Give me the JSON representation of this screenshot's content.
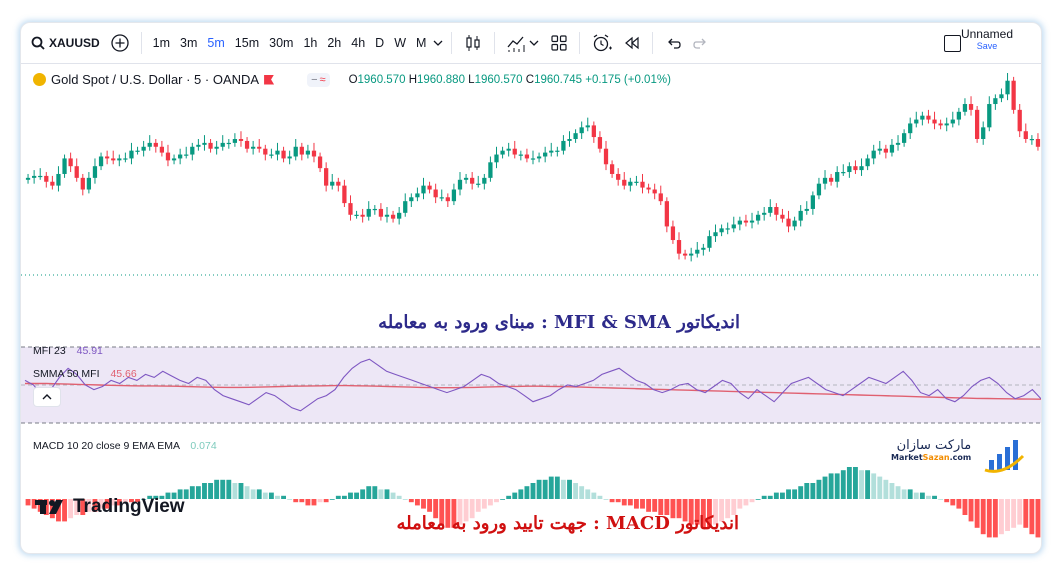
{
  "toolbar": {
    "symbol": "XAUUSD",
    "timeframes": [
      "1m",
      "3m",
      "5m",
      "15m",
      "30m",
      "1h",
      "2h",
      "4h",
      "D",
      "W",
      "M"
    ],
    "active_timeframe": "5m",
    "layout_name": "Unnamed",
    "save_label": "Save"
  },
  "legend": {
    "title": "Gold Spot / U.S. Dollar · 5 · OANDA",
    "open_label": "O",
    "open": "1960.570",
    "high_label": "H",
    "high": "1960.880",
    "low_label": "L",
    "low": "1960.570",
    "close_label": "C",
    "close": "1960.745",
    "change": "+0.175 (+0.01%)"
  },
  "mfi": {
    "label": "MFI 23",
    "value": "45.91",
    "sma_label": "SMMA 50 MFI",
    "sma_value": "45.66"
  },
  "macd": {
    "label": "MACD 10 20 close 9 EMA EMA",
    "value": "0.074"
  },
  "captions": {
    "mfi_caption": "اندیکاتور MFI & SMA : مبنای ورود به معامله",
    "macd_caption": "اندیکاتور  MACD : جهت تایید ورود به معامله"
  },
  "branding": {
    "tradingview": "TradingView",
    "brand_fa": "مارکت سازان",
    "brand_en_1": "Market",
    "brand_en_2": "Sazan",
    "brand_en_3": ".com"
  },
  "colors": {
    "up": "#089981",
    "down": "#f23645",
    "mfi_line": "#7e57c2",
    "smma_line": "#e06070",
    "mfi_band": "#ede7f6",
    "accent": "#2962ff"
  },
  "chart_data": [
    {
      "type": "candlestick",
      "title": "Gold Spot / U.S. Dollar · 5 · OANDA",
      "series": [
        {
          "name": "XAUUSD",
          "close": [
            140,
            141,
            141,
            138,
            136,
            142,
            150,
            146,
            140,
            134,
            140,
            146,
            151,
            150,
            149,
            150,
            150,
            154,
            154,
            156,
            158,
            156,
            153,
            149,
            150,
            152,
            152,
            156,
            157,
            158,
            155,
            156,
            158,
            158,
            160,
            159,
            155,
            156,
            155,
            152,
            152,
            154,
            150,
            151,
            156,
            152,
            154,
            151,
            145,
            136,
            138,
            136,
            127,
            121,
            121,
            120,
            124,
            124,
            120,
            121,
            119,
            122,
            128,
            130,
            132,
            136,
            134,
            130,
            130,
            128,
            134,
            139,
            140,
            137,
            137,
            140,
            148,
            152,
            154,
            155,
            152,
            152,
            150,
            150,
            151,
            153,
            154,
            154,
            159,
            160,
            163,
            166,
            167,
            161,
            155,
            147,
            142,
            139,
            136,
            138,
            138,
            135,
            134,
            132,
            128,
            115,
            108,
            101,
            100,
            101,
            103,
            104,
            110,
            112,
            114,
            114,
            116,
            118,
            117,
            118,
            121,
            122,
            125,
            121,
            119,
            115,
            118,
            123,
            124,
            131,
            137,
            140,
            138,
            143,
            143,
            146,
            144,
            146,
            150,
            154,
            155,
            153,
            157,
            158,
            163,
            168,
            170,
            172,
            170,
            168,
            167,
            168,
            170,
            174,
            178,
            175,
            160,
            166,
            178,
            181,
            183,
            190,
            175,
            164,
            160,
            160,
            156
          ]
        }
      ]
    },
    {
      "type": "line",
      "title": "MFI 23",
      "series": [
        {
          "name": "MFI 23",
          "values": [
            58,
            55,
            48,
            52,
            60,
            66,
            62,
            55,
            52,
            54,
            58,
            56,
            60,
            58,
            62,
            60,
            64,
            61,
            58,
            56,
            60,
            58,
            52,
            48,
            46,
            44,
            42,
            46,
            50,
            48,
            44,
            40,
            38,
            42,
            46,
            48,
            52,
            60,
            66,
            70,
            72,
            68,
            64,
            62,
            60,
            58,
            56,
            54,
            52,
            50,
            52,
            54,
            58,
            62,
            60,
            56,
            54,
            52,
            48,
            44,
            46,
            48,
            52,
            55,
            54,
            56,
            58,
            62,
            64,
            66,
            62,
            58,
            56,
            52,
            50,
            52,
            55,
            56,
            52,
            50,
            54,
            58,
            56,
            50,
            46,
            52,
            48,
            44,
            50,
            56,
            58,
            60,
            56,
            52,
            50,
            48,
            52,
            56,
            60,
            58,
            56,
            60,
            64,
            58,
            50,
            48,
            52,
            46,
            44,
            48,
            54,
            58,
            60,
            56,
            50,
            46,
            48,
            52,
            45.91
          ]
        },
        {
          "name": "SMMA 50 MFI",
          "values": [
            56,
            56,
            56,
            55.8,
            55.6,
            55.4,
            55.2,
            55,
            54.8,
            54.6,
            54.5,
            54.4,
            54.4,
            54.3,
            54.2,
            54,
            53.8,
            53.6,
            53.5,
            53.4,
            53.4,
            53.5,
            53.6,
            53.8,
            54,
            54.2,
            54.3,
            54.4,
            54.5,
            54.6,
            54.6,
            54.5,
            54.4,
            54.2,
            54,
            53.8,
            53.6,
            53.4,
            53.3,
            53.2,
            53.2,
            53.3,
            53.4,
            53.6,
            53.8,
            54,
            54.1,
            54.2,
            54.2,
            54.1,
            54,
            53.8,
            53.6,
            53.4,
            53.2,
            53,
            52.8,
            52.6,
            52.4,
            52.2,
            52,
            51.8,
            51.6,
            51.4,
            51.2,
            51,
            50.8,
            50.6,
            50.4,
            50.2,
            50,
            49.8,
            49.6,
            49.4,
            49.2,
            49,
            48.8,
            48.6,
            48.4,
            48.2,
            48,
            47.8,
            47.6,
            47.4,
            47.2,
            47,
            46.8,
            46.6,
            46.4,
            46.2,
            46.1,
            46,
            45.9,
            45.8,
            45.7,
            45.66
          ]
        }
      ]
    },
    {
      "type": "bar",
      "title": "MACD 10 20 close 9 EMA EMA",
      "series": [
        {
          "name": "Histogram",
          "values": [
            -2,
            -3,
            -4,
            -5,
            -6,
            -7,
            -7,
            -6,
            -5,
            -5,
            -4,
            -4,
            -3,
            -3,
            -2,
            -2,
            -1,
            -1,
            -1,
            0,
            1,
            1,
            1,
            2,
            2,
            3,
            3,
            4,
            4,
            5,
            5,
            6,
            6,
            6,
            5,
            5,
            4,
            3,
            3,
            2,
            2,
            1,
            1,
            0,
            -1,
            -1,
            -2,
            -2,
            -1,
            -1,
            0,
            1,
            1,
            2,
            2,
            3,
            4,
            4,
            3,
            3,
            2,
            1,
            0,
            -1,
            -2,
            -3,
            -4,
            -6,
            -8,
            -9,
            -9,
            -8,
            -7,
            -6,
            -4,
            -3,
            -2,
            -1,
            0,
            1,
            2,
            3,
            4,
            5,
            6,
            6,
            7,
            7,
            6,
            6,
            5,
            4,
            3,
            2,
            1,
            0,
            -1,
            -1,
            -2,
            -2,
            -3,
            -3,
            -4,
            -4,
            -5,
            -5,
            -6,
            -6,
            -7,
            -8,
            -8,
            -9,
            -9,
            -8,
            -7,
            -6,
            -5,
            -3,
            -2,
            -1,
            0,
            1,
            1,
            2,
            2,
            3,
            3,
            4,
            5,
            5,
            6,
            7,
            8,
            8,
            9,
            10,
            10,
            9,
            9,
            8,
            7,
            6,
            5,
            4,
            3,
            3,
            2,
            2,
            1,
            1,
            0,
            -1,
            -2,
            -3,
            -5,
            -7,
            -9,
            -11,
            -12,
            -12,
            -11,
            -10,
            -9,
            -8,
            -9,
            -11,
            -12
          ]
        }
      ]
    }
  ]
}
